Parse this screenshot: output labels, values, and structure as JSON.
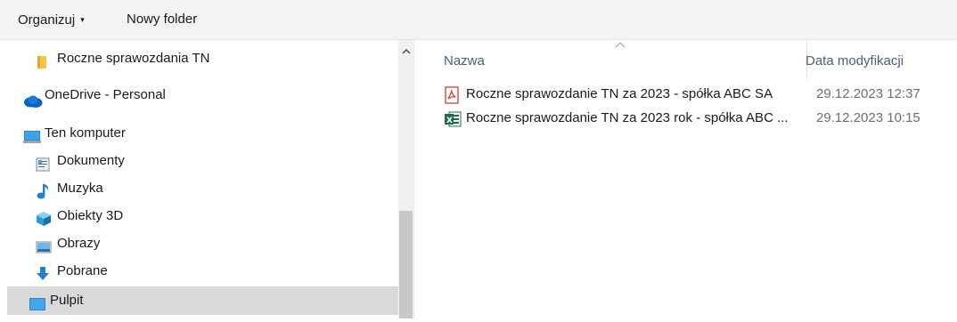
{
  "toolbar": {
    "organize_label": "Organizuj",
    "organize_caret": "▾",
    "new_folder_label": "Nowy folder"
  },
  "nav": {
    "items": [
      {
        "label": "Roczne sprawozdania TN",
        "icon": "folder-icon"
      },
      {
        "label": "OneDrive - Personal",
        "icon": "cloud-icon"
      },
      {
        "label": "Ten komputer",
        "icon": "computer-icon"
      },
      {
        "label": "Dokumenty",
        "icon": "document-icon"
      },
      {
        "label": "Muzyka",
        "icon": "music-note-icon"
      },
      {
        "label": "Obiekty 3D",
        "icon": "cube-3d-icon"
      },
      {
        "label": "Obrazy",
        "icon": "picture-icon"
      },
      {
        "label": "Pobrane",
        "icon": "download-arrow-icon"
      },
      {
        "label": "Pulpit",
        "icon": "desktop-icon",
        "selected": true
      }
    ],
    "scroll_up_glyph": "^"
  },
  "list": {
    "headers": {
      "name": "Nazwa",
      "date": "Data modyfikacji"
    },
    "sort_glyph": "^",
    "files": [
      {
        "name": "Roczne sprawozdanie TN za 2023 - spółka ABC SA",
        "date": "29.12.2023 12:37",
        "icon": "pdf-icon"
      },
      {
        "name": "Roczne sprawozdanie TN za 2023 rok - spółka ABC ...",
        "date": "29.12.2023 10:15",
        "icon": "excel-icon"
      }
    ]
  },
  "colors": {
    "toolbar_bg": "#f3f3f3",
    "selected_bg": "#d9d9d9",
    "header_text": "#4a5f7a",
    "date_text": "#6e6e6e"
  }
}
